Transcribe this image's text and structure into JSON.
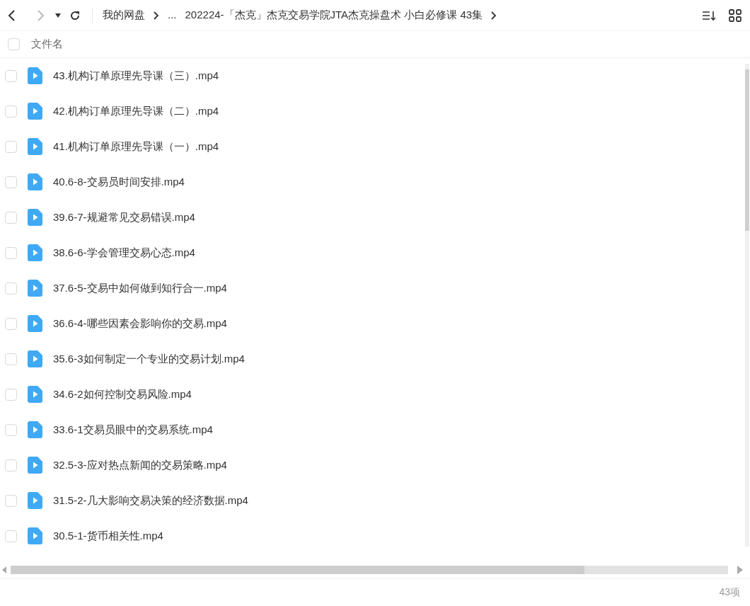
{
  "breadcrumb": [
    {
      "label": "我的网盘"
    },
    {
      "label": "..."
    },
    {
      "label": "202224-「杰克」杰克交易学院JTA杰克操盘术 小白必修课 43集"
    }
  ],
  "header": {
    "checked": false,
    "label": "文件名"
  },
  "files": [
    {
      "name": "43.机构订单原理先导课（三）.mp4",
      "checked": false
    },
    {
      "name": "42.机构订单原理先导课（二）.mp4",
      "checked": false
    },
    {
      "name": "41.机构订单原理先导课（一）.mp4",
      "checked": false
    },
    {
      "name": "40.6-8-交易员时间安排.mp4",
      "checked": false
    },
    {
      "name": "39.6-7-规避常见交易错误.mp4",
      "checked": false
    },
    {
      "name": "38.6-6-学会管理交易心态.mp4",
      "checked": false
    },
    {
      "name": "37.6-5-交易中如何做到知行合一.mp4",
      "checked": false
    },
    {
      "name": "36.6-4-哪些因素会影响你的交易.mp4",
      "checked": false
    },
    {
      "name": "35.6-3如何制定一个专业的交易计划.mp4",
      "checked": false
    },
    {
      "name": "34.6-2如何控制交易风险.mp4",
      "checked": false
    },
    {
      "name": "33.6-1交易员眼中的交易系统.mp4",
      "checked": false
    },
    {
      "name": "32.5-3-应对热点新闻的交易策略.mp4",
      "checked": false
    },
    {
      "name": "31.5-2-几大影响交易决策的经济数据.mp4",
      "checked": false
    },
    {
      "name": "30.5-1-货币相关性.mp4",
      "checked": false
    }
  ],
  "status_bar": {
    "count": "43项"
  }
}
